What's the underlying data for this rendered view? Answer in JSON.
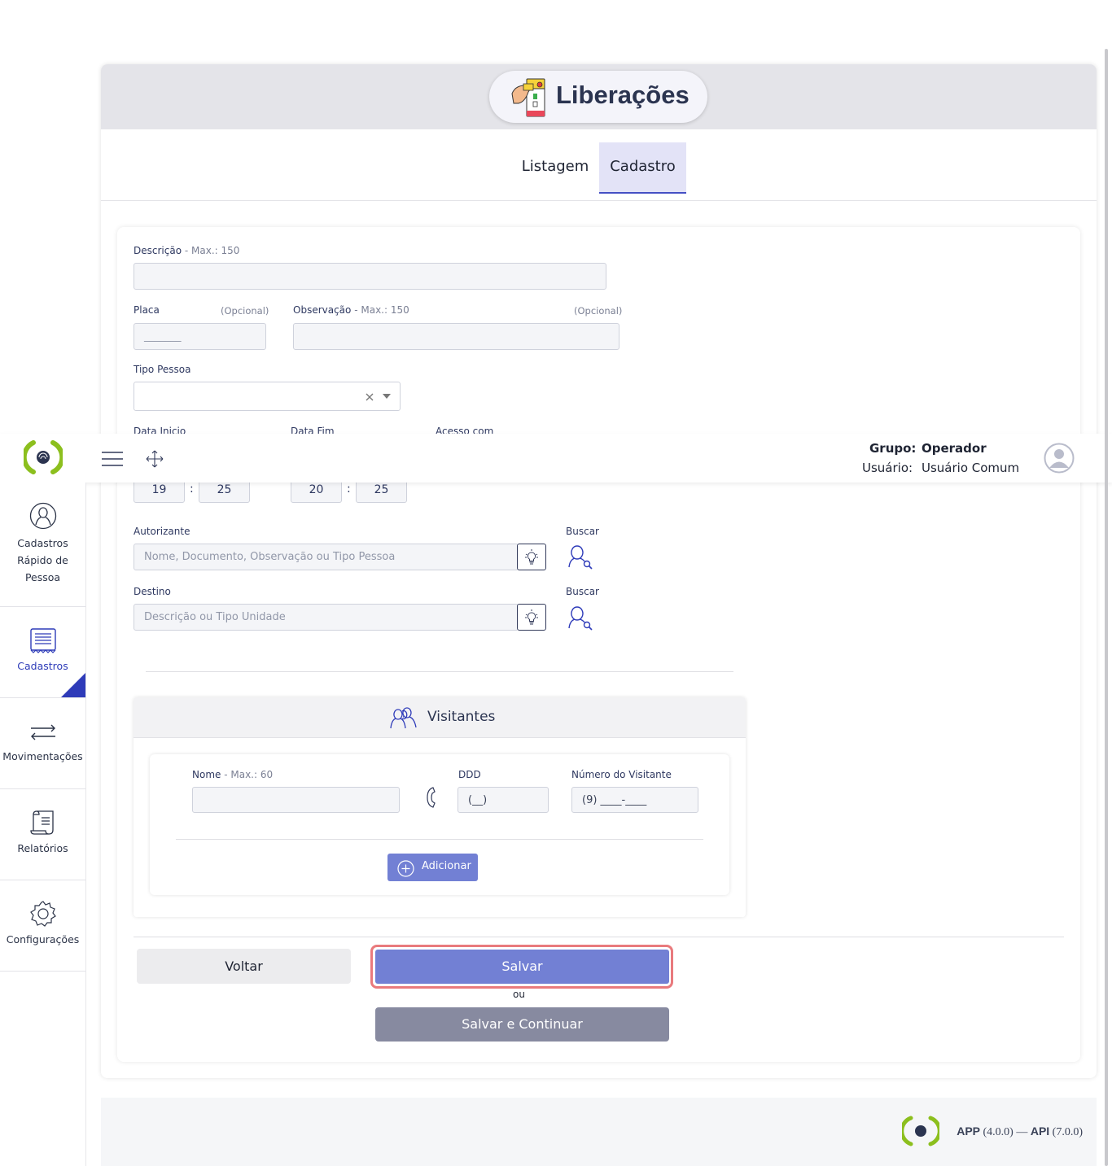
{
  "header": {
    "group_label": "Grupo:",
    "group_value": "Operador",
    "user_label": "Usuário:",
    "user_value": "Usuário Comum"
  },
  "sidebar": {
    "items": [
      {
        "label": "Cadastros Rápido de Pessoa",
        "icon": "user-circle-icon"
      },
      {
        "label": "Cadastros",
        "icon": "receipt-icon",
        "active": true
      },
      {
        "label": "Movimentações",
        "icon": "transfer-arrows-icon"
      },
      {
        "label": "Relatórios",
        "icon": "report-scroll-icon"
      },
      {
        "label": "Configurações",
        "icon": "gear-icon"
      }
    ]
  },
  "page": {
    "title": "Liberações",
    "tabs": [
      {
        "label": "Listagem",
        "active": false
      },
      {
        "label": "Cadastro",
        "active": true
      }
    ]
  },
  "form": {
    "descricao": {
      "label": "Descrição",
      "hint": "- Max.: 150",
      "value": ""
    },
    "placa": {
      "label": "Placa",
      "optional": "(Opcional)",
      "placeholder": "_______"
    },
    "observacao": {
      "label": "Observação",
      "hint": "- Max.: 150",
      "optional": "(Opcional)",
      "value": ""
    },
    "tipo_pessoa": {
      "label": "Tipo Pessoa",
      "value": ""
    },
    "data_inicio": {
      "label": "Data Inicio",
      "hour": "19",
      "minute": "25"
    },
    "data_fim": {
      "label": "Data Fim",
      "hour": "20",
      "minute": "25"
    },
    "acesso_com": {
      "label": "Acesso com"
    },
    "time_separator": ":",
    "autorizante": {
      "label": "Autorizante",
      "placeholder": "Nome, Documento, Observação ou Tipo Pessoa",
      "search_label": "Buscar"
    },
    "destino": {
      "label": "Destino",
      "placeholder": "Descrição ou Tipo Unidade",
      "search_label": "Buscar"
    }
  },
  "visitantes": {
    "title": "Visitantes",
    "nome": {
      "label": "Nome",
      "hint": "- Max.: 60",
      "value": ""
    },
    "ddd": {
      "label": "DDD",
      "placeholder": "(__)"
    },
    "numero": {
      "label": "Número do Visitante",
      "placeholder": "(9) ____-____"
    },
    "add_label": "Adicionar"
  },
  "actions": {
    "voltar": "Voltar",
    "salvar": "Salvar",
    "ou": "ou",
    "salvar_continuar": "Salvar e Continuar"
  },
  "footer": {
    "app_label": "APP",
    "app_version": "(4.0.0)",
    "separator": "—",
    "api_label": "API",
    "api_version": "(7.0.0)"
  },
  "colors": {
    "brand_green": "#8cbf1e",
    "accent_blue": "#2e3bb9",
    "primary_button": "#7280d4",
    "secondary_button": "#878aa0",
    "highlight_outline": "#e97a7d"
  }
}
